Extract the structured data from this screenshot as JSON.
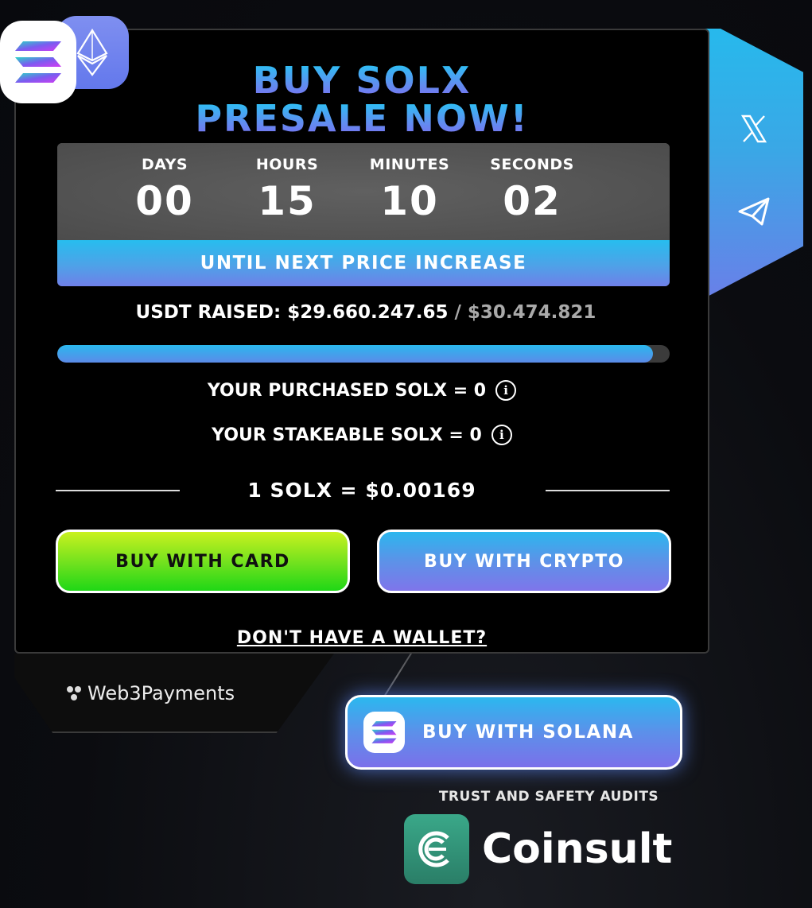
{
  "title": {
    "line1": "BUY SOLX",
    "line2": "PRESALE NOW!"
  },
  "countdown": {
    "labels": {
      "days": "DAYS",
      "hours": "HOURS",
      "minutes": "MINUTES",
      "seconds": "SECONDS"
    },
    "values": {
      "days": "00",
      "hours": "15",
      "minutes": "10",
      "seconds": "02"
    },
    "caption": "UNTIL NEXT PRICE INCREASE"
  },
  "raised": {
    "label": "USDT RAISED:",
    "amount": "$29.660.247.65",
    "separator": "/",
    "goal": "$30.474.821",
    "progress_percent": 97.3
  },
  "stats": {
    "purchased": "YOUR PURCHASED SOLX = 0",
    "stakeable": "YOUR STAKEABLE SOLX = 0",
    "info_glyph": "i"
  },
  "price": "1 SOLX = $0.00169",
  "buttons": {
    "card": "BUY WITH CARD",
    "crypto": "BUY WITH CRYPTO",
    "solana": "BUY WITH SOLANA"
  },
  "wallet_link": "DON'T HAVE A WALLET?",
  "tab": {
    "label": "Web3Payments"
  },
  "audits": {
    "heading": "TRUST AND SAFETY AUDITS",
    "brand": "Coinsult"
  },
  "social": {
    "icons": [
      "x-icon",
      "telegram-icon"
    ]
  },
  "colors": {
    "accent_blue": "#27b9ec",
    "accent_purple": "#7b70ea",
    "accent_green": "#6de11e",
    "coinsult_green": "#3aa889"
  }
}
